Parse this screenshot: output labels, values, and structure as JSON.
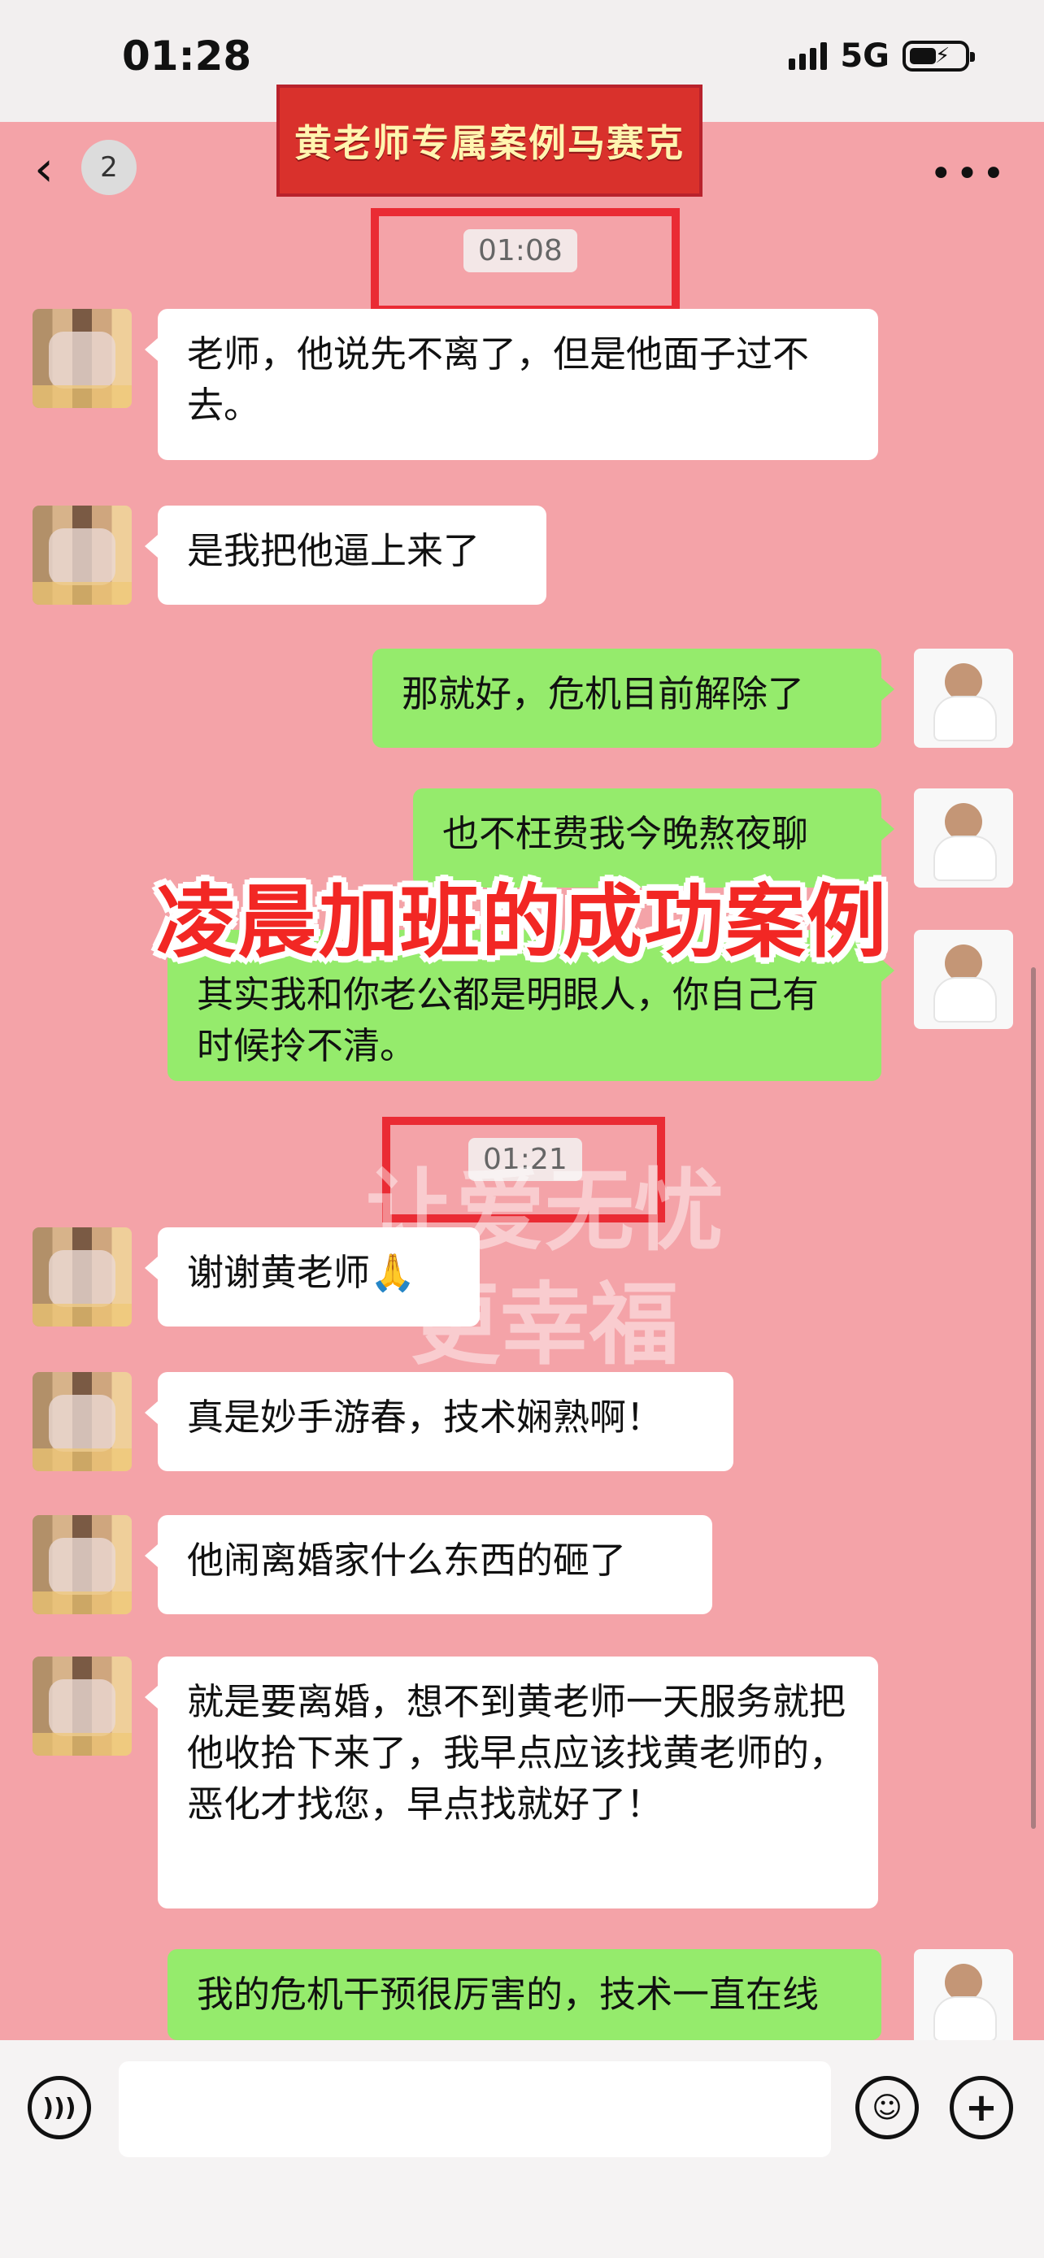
{
  "status_bar": {
    "time": "01:28",
    "network": "5G"
  },
  "header": {
    "back_icon": "chevron-left-icon",
    "unread_count": "2",
    "title": "黄老师专属案例马赛克",
    "more_icon": "more-horizontal-icon"
  },
  "chat": {
    "timestamps": [
      "01:08",
      "01:21"
    ],
    "messages": [
      {
        "side": "left",
        "text": "老师，他说先不离了，但是他面子过不去。"
      },
      {
        "side": "left",
        "text": "是我把他逼上来了"
      },
      {
        "side": "right",
        "text": "那就好，危机目前解除了"
      },
      {
        "side": "right",
        "text": "也不枉费我今晚熬夜聊"
      },
      {
        "side": "right",
        "text": "其实我和你老公都是明眼人，你自己有时候拎不清。"
      },
      {
        "side": "left",
        "text": "谢谢黄老师🙏"
      },
      {
        "side": "left",
        "text": "真是妙手游春，技术娴熟啊！"
      },
      {
        "side": "left",
        "text": "他闹离婚家什么东西的砸了"
      },
      {
        "side": "left",
        "text": "就是要离婚，想不到黄老师一天服务就把他收拾下来了，我早点应该找黄老师的，恶化才找您，早点找就好了！"
      },
      {
        "side": "right",
        "text": "我的危机干预很厉害的，技术一直在线"
      }
    ]
  },
  "overlay": {
    "headline": "凌晨加班的成功案例",
    "watermark_line1": "让爱无忧",
    "watermark_line2": "更幸福"
  },
  "input_bar": {
    "voice_icon": "voice-icon",
    "emoji_icon": "emoji-icon",
    "add_icon": "plus-icon",
    "placeholder": ""
  },
  "colors": {
    "chat_background": "#f4a3a8",
    "left_bubble": "#ffffff",
    "right_bubble": "#95eb6c",
    "highlight_box": "#ea2b34"
  }
}
